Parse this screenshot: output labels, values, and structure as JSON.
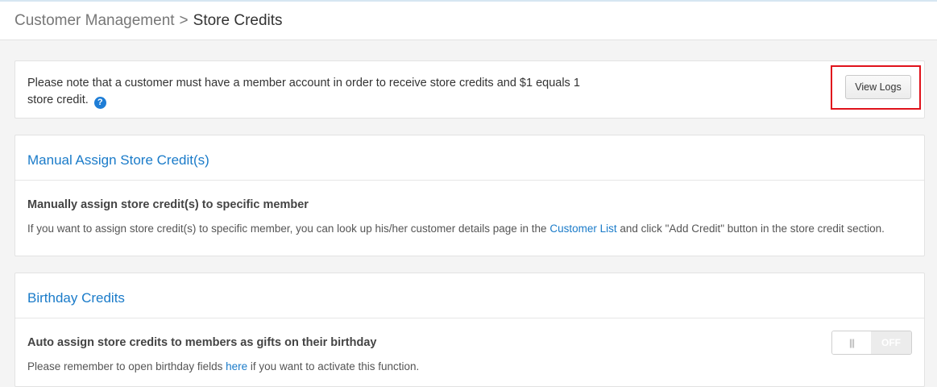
{
  "breadcrumb": {
    "parent": "Customer Management",
    "separator": ">",
    "current": "Store Credits"
  },
  "note": {
    "text": "Please note that a customer must have a member account in order to receive store credits and $1 equals 1 store credit.",
    "help_icon": "?",
    "view_logs_label": "View Logs"
  },
  "manual": {
    "title": "Manual Assign Store Credit(s)",
    "heading": "Manually assign store credit(s) to specific member",
    "desc_before": "If you want to assign store credit(s) to specific member, you can look up his/her customer details page in the ",
    "link_text": "Customer List",
    "desc_after": " and click \"Add Credit\" button in the store credit section."
  },
  "birthday": {
    "title": "Birthday Credits",
    "heading": "Auto assign store credits to members as gifts on their birthday",
    "desc_before": "Please remember to open birthday fields ",
    "link_text": "here",
    "desc_after": " if you want to activate this function.",
    "toggle_handle": "|||",
    "toggle_state": "OFF"
  },
  "colors": {
    "accent": "#1a7bc9",
    "highlight": "#e0121b"
  }
}
